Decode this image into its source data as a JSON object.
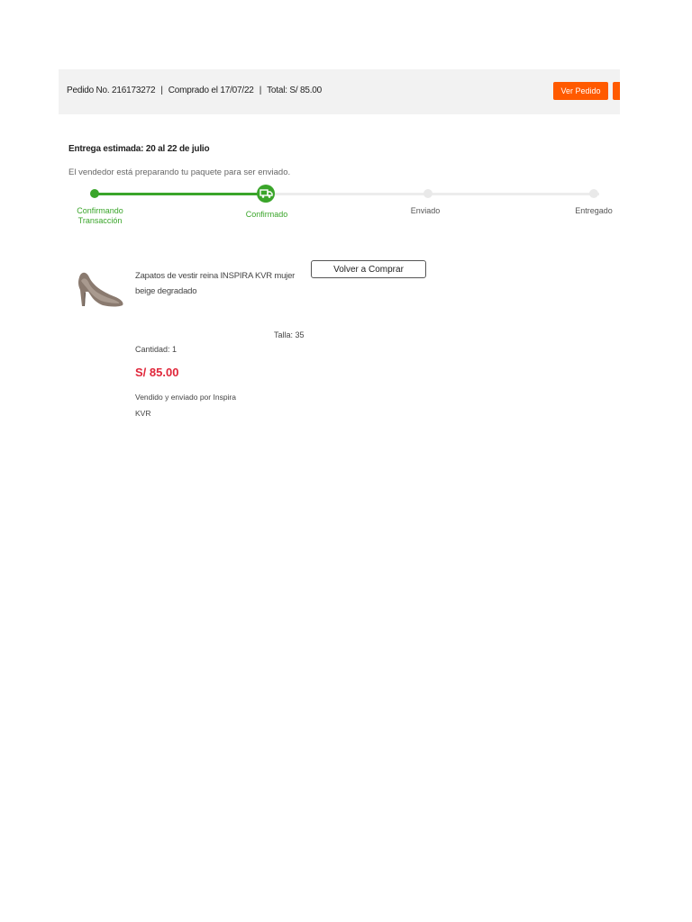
{
  "header": {
    "order_label": "Pedido No. 216173272",
    "purchase_date": "Comprado el 17/07/22",
    "total": "Total: S/ 85.00",
    "separator": "|",
    "view_order_button": "Ver Pedido"
  },
  "delivery": {
    "estimate": "Entrega estimada: 20 al 22 de julio",
    "status_message": "El vendedor está preparando tu paquete para ser enviado."
  },
  "tracking": {
    "steps": [
      {
        "label": "Confirmando Transacción",
        "state": "done"
      },
      {
        "label": "Confirmado",
        "state": "current"
      },
      {
        "label": "Enviado",
        "state": "pending"
      },
      {
        "label": "Entregado",
        "state": "pending"
      }
    ],
    "current_step_icon": "truck-icon"
  },
  "product": {
    "name": "Zapatos de vestir reina INSPIRA KVR mujer beige degradado",
    "size": "Talla: 35",
    "quantity": "Cantidad: 1",
    "price": "S/ 85.00",
    "seller": "Vendido y enviado por Inspira KVR",
    "rebuy_button": "Volver a Comprar",
    "image_icon": "shoe-image"
  },
  "colors": {
    "accent": "#ff5a00",
    "progress_green": "#3aa52a",
    "price_red": "#e0263a"
  }
}
